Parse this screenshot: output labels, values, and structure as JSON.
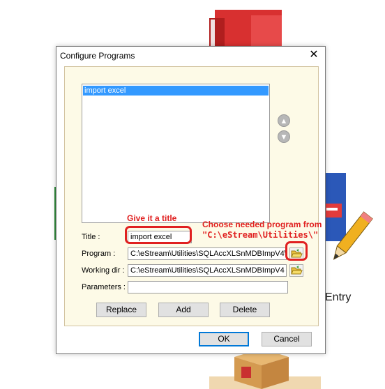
{
  "background": {
    "desktop_label": "Entry"
  },
  "dialog": {
    "title": "Configure Programs",
    "list_items": [
      "import excel"
    ],
    "fields": {
      "title_label": "Title :",
      "title_value": "import excel",
      "program_label": "Program :",
      "program_value": "C:\\eStream\\Utilities\\SQLAccXLSnMDBImpV4\\SQ",
      "working_dir_label": "Working dir :",
      "working_dir_value": "C:\\eStream\\Utilities\\SQLAccXLSnMDBImpV4",
      "parameters_label": "Parameters :",
      "parameters_value": ""
    },
    "buttons": {
      "replace": "Replace",
      "add": "Add",
      "delete": "Delete",
      "ok": "OK",
      "cancel": "Cancel"
    }
  },
  "annotations": {
    "give_title": "Give it a title",
    "choose_program_line1": "Choose needed program from",
    "choose_program_line2": "\"C:\\eStream\\Utilities\\\""
  },
  "colors": {
    "selection": "#3399ff",
    "panel_bg": "#fdfae7",
    "annotation_red": "#e02020",
    "ok_border": "#0078d7"
  }
}
